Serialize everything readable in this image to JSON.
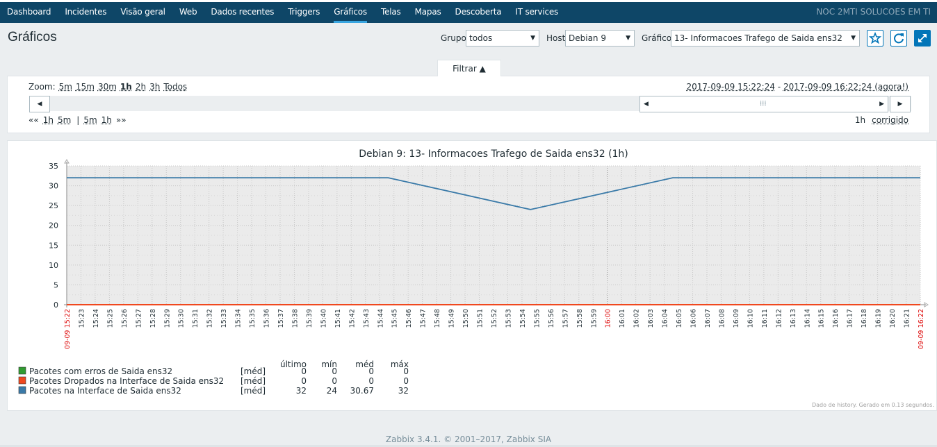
{
  "nav": {
    "items": [
      {
        "label": "Dashboard",
        "active": false
      },
      {
        "label": "Incidentes",
        "active": false
      },
      {
        "label": "Visão geral",
        "active": false
      },
      {
        "label": "Web",
        "active": false
      },
      {
        "label": "Dados recentes",
        "active": false
      },
      {
        "label": "Triggers",
        "active": false
      },
      {
        "label": "Gráficos",
        "active": true
      },
      {
        "label": "Telas",
        "active": false
      },
      {
        "label": "Mapas",
        "active": false
      },
      {
        "label": "Descoberta",
        "active": false
      },
      {
        "label": "IT services",
        "active": false
      }
    ],
    "brand": "NOC 2MTI SOLUCOES EM TI"
  },
  "header": {
    "title": "Gráficos",
    "group_label": "Grupo",
    "group_value": "todos",
    "host_label": "Host",
    "host_value": "Debian 9",
    "graph_label": "Gráfico",
    "graph_value": "13- Informacoes Trafego de Saida ens32",
    "favorite_icon": "star-icon",
    "refresh_icon": "refresh-icon",
    "fullscreen_icon": "fullscreen-icon"
  },
  "filter": {
    "tab_label": "Filtrar ▲",
    "zoom_label": "Zoom:",
    "zoom_options": [
      "5m",
      "15m",
      "30m",
      "1h",
      "2h",
      "3h",
      "Todos"
    ],
    "zoom_selected": "1h",
    "period_from": "2017-09-09 15:22:24",
    "period_separator": " - ",
    "period_to": "2017-09-09 16:22:24 (agora!)",
    "nav_back_all": "««",
    "nav_back": [
      "1h",
      "5m"
    ],
    "nav_sep": "|",
    "nav_fwd": [
      "5m",
      "1h"
    ],
    "nav_fwd_all": "»»",
    "period_value": "1h",
    "fixed_label": "corrigido"
  },
  "chart_data": {
    "type": "line",
    "title": "Debian 9: 13- Informacoes Trafego de Saida ens32 (1h)",
    "ylim": [
      0,
      35
    ],
    "yticks": [
      0,
      5,
      10,
      15,
      20,
      25,
      30,
      35
    ],
    "x_start_label": "09-09 15:22",
    "x_end_label": "09-09 16:22",
    "x_labels": [
      "15:23",
      "15:24",
      "15:25",
      "15:26",
      "15:27",
      "15:28",
      "15:29",
      "15:30",
      "15:31",
      "15:32",
      "15:33",
      "15:34",
      "15:35",
      "15:36",
      "15:37",
      "15:38",
      "15:39",
      "15:40",
      "15:41",
      "15:42",
      "15:43",
      "15:44",
      "15:45",
      "15:46",
      "15:47",
      "15:48",
      "15:49",
      "15:50",
      "15:51",
      "15:52",
      "15:53",
      "15:54",
      "15:55",
      "15:56",
      "15:57",
      "15:58",
      "15:59",
      "16:00",
      "16:01",
      "16:02",
      "16:03",
      "16:04",
      "16:05",
      "16:06",
      "16:07",
      "16:08",
      "16:09",
      "16:10",
      "16:11",
      "16:12",
      "16:13",
      "16:14",
      "16:15",
      "16:16",
      "16:17",
      "16:18",
      "16:19",
      "16:20",
      "16:21"
    ],
    "highlight_label": "16:00",
    "x_minutes_range": [
      0,
      60
    ],
    "grid": true,
    "series": [
      {
        "name": "Pacotes com erros de Saida ens32",
        "color": "#319c31",
        "x": [
          0,
          60
        ],
        "y": [
          0,
          0
        ]
      },
      {
        "name": "Pacotes Dropados na Interface de Saida ens32",
        "color": "#f0481e",
        "x": [
          0,
          60
        ],
        "y": [
          0,
          0
        ]
      },
      {
        "name": "Pacotes na Interface de Saida ens32",
        "color": "#3a7aa8",
        "x": [
          0,
          22.6,
          32.6,
          42.6,
          60
        ],
        "y": [
          32,
          32,
          24,
          32,
          32
        ]
      }
    ],
    "legend_headers": [
      "último",
      "mín",
      "méd",
      "máx"
    ],
    "legend_rows": [
      {
        "name": "Pacotes com erros de Saida ens32",
        "color": "#319c31",
        "func": "[méd]",
        "last": "0",
        "min": "0",
        "avg": "0",
        "max": "0"
      },
      {
        "name": "Pacotes Dropados na Interface de Saida ens32",
        "color": "#f0481e",
        "func": "[méd]",
        "last": "0",
        "min": "0",
        "avg": "0",
        "max": "0"
      },
      {
        "name": "Pacotes na Interface de Saida ens32",
        "color": "#3a7aa8",
        "func": "[méd]",
        "last": "32",
        "min": "24",
        "avg": "30.67",
        "max": "32"
      }
    ],
    "data_note": "Dado de history. Gerado em 0.13 segundos."
  },
  "footer": "Zabbix 3.4.1. © 2001–2017, Zabbix SIA"
}
